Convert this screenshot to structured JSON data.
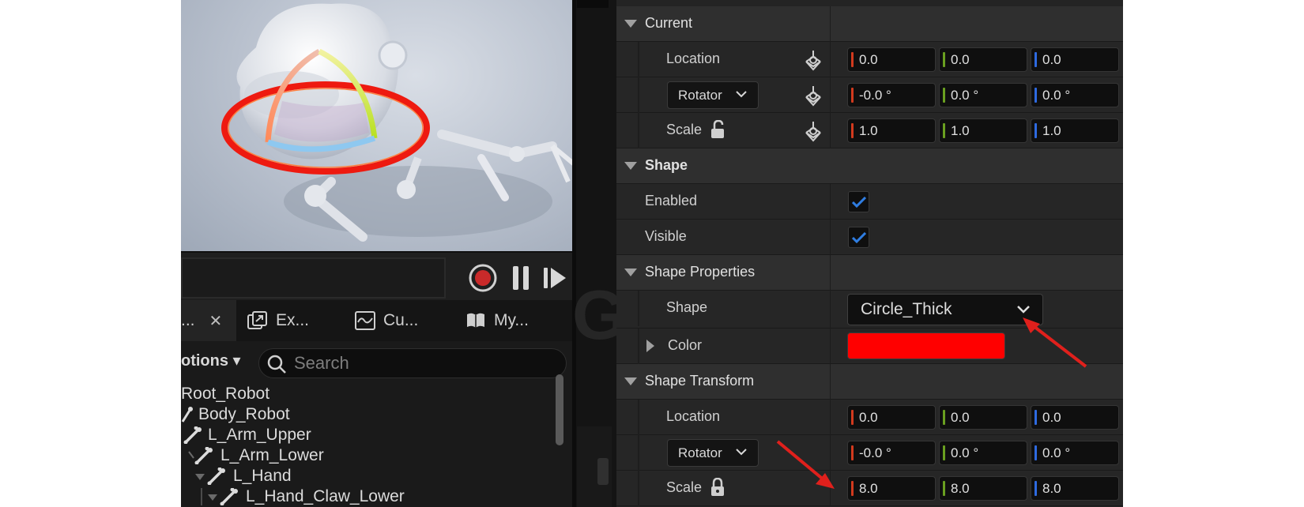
{
  "transport": {
    "record_icon": "record-icon",
    "pause_icon": "pause-icon",
    "step_icon": "step-forward-icon"
  },
  "tabs": [
    {
      "label": "...",
      "icon": "skeleton-tree-icon",
      "close": "✕"
    },
    {
      "label": "Ex...",
      "icon": "export-icon"
    },
    {
      "label": "Cu...",
      "icon": "curves-icon"
    },
    {
      "label": "My...",
      "icon": "book-icon"
    }
  ],
  "options": {
    "label": "otions ▾"
  },
  "search": {
    "placeholder": "Search"
  },
  "tree": [
    {
      "label": "Root_Robot",
      "icon": "root-bone-icon"
    },
    {
      "label": "Body_Robot",
      "icon": "bone-icon"
    },
    {
      "label": "L_Arm_Upper",
      "icon": "bone-icon"
    },
    {
      "label": "L_Arm_Lower",
      "icon": "bone-icon"
    },
    {
      "label": "L_Hand",
      "icon": "bone-icon"
    },
    {
      "label": "L_Hand_Claw_Lower",
      "icon": "bone-icon"
    }
  ],
  "details": {
    "current": {
      "title": "Current",
      "location": {
        "label": "Location",
        "x": "0.0",
        "y": "0.0",
        "z": "0.0"
      },
      "rotator": {
        "label": "Rotator",
        "x": "-0.0 °",
        "y": "0.0 °",
        "z": "0.0 °"
      },
      "scale": {
        "label": "Scale",
        "x": "1.0",
        "y": "1.0",
        "z": "1.0",
        "locked": false
      }
    },
    "shape": {
      "title": "Shape",
      "enabled": {
        "label": "Enabled",
        "checked": true
      },
      "visible": {
        "label": "Visible",
        "checked": true
      }
    },
    "shape_properties": {
      "title": "Shape Properties",
      "shape": {
        "label": "Shape",
        "value": "Circle_Thick"
      },
      "color": {
        "label": "Color",
        "value": "#ff0000"
      }
    },
    "shape_transform": {
      "title": "Shape Transform",
      "location": {
        "label": "Location",
        "x": "0.0",
        "y": "0.0",
        "z": "0.0"
      },
      "rotator": {
        "label": "Rotator",
        "x": "-0.0 °",
        "y": "0.0 °",
        "z": "0.0 °"
      },
      "scale": {
        "label": "Scale",
        "x": "8.0",
        "y": "8.0",
        "z": "8.0",
        "locked": true
      }
    }
  },
  "colors": {
    "axis_x": "#d23a1e",
    "axis_y": "#6aa020",
    "axis_z": "#2e6ae0",
    "checkbox_check": "#2f7de1",
    "annotation_arrow": "#e0201c"
  }
}
